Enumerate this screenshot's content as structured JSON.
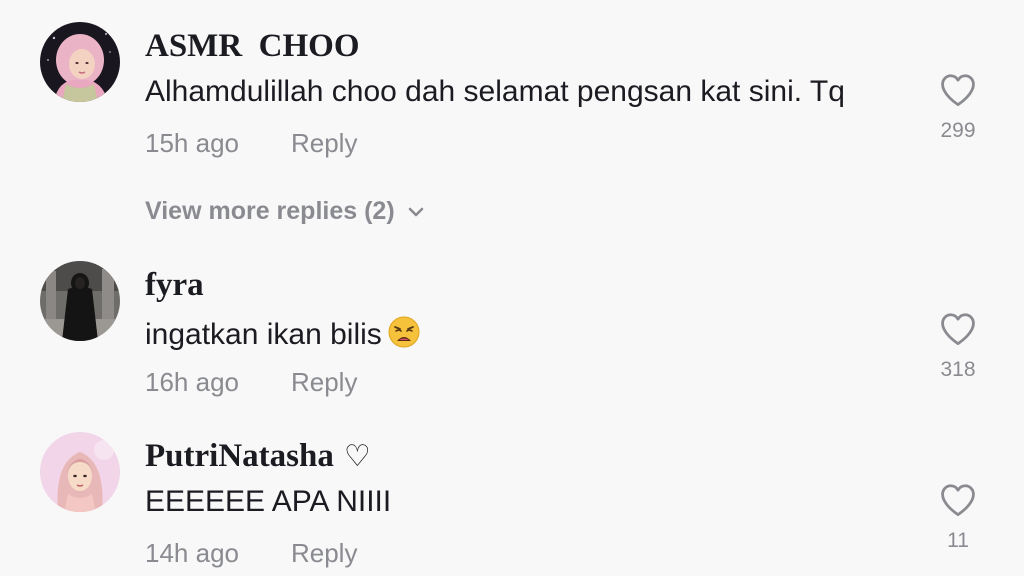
{
  "comments": [
    {
      "username": "ASMR  CHOO",
      "text": "Alhamdulillah choo dah selamat pengsan kat sini. Tq",
      "time": "15h ago",
      "reply_label": "Reply",
      "likes": "299",
      "avatar_icon": "avatar-pink-hijab-photo"
    },
    {
      "username": "fyra",
      "text": "ingatkan ikan bilis",
      "emoji": "weary-face-emoji",
      "time": "16h ago",
      "reply_label": "Reply",
      "likes": "318",
      "avatar_icon": "avatar-black-abaya-photo"
    },
    {
      "username": "PutriNatasha",
      "badge": "♡",
      "text": "EEEEEE APA NIIII",
      "time": "14h ago",
      "reply_label": "Reply",
      "likes": "11",
      "avatar_icon": "avatar-cartoon-hijab-girl"
    }
  ],
  "view_more_replies": "View more replies (2)",
  "colors": {
    "background": "#f8f8f8",
    "text_primary": "#1b1b22",
    "text_secondary": "#8a8b91"
  }
}
